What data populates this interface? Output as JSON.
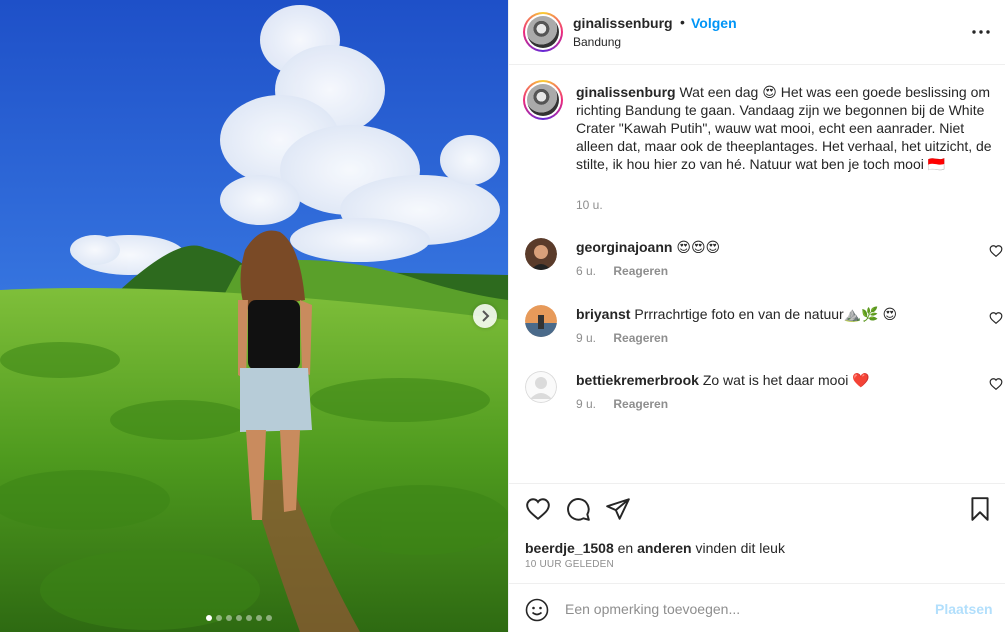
{
  "header": {
    "username": "ginalissenburg",
    "separator": "•",
    "follow_label": "Volgen",
    "location": "Bandung",
    "more_icon": "more-horizontal-icon"
  },
  "caption": {
    "username": "ginalissenburg",
    "text": "Wat een dag 😍 Het was een goede beslissing om richting Bandung te gaan. Vandaag zijn we begonnen bij de White Crater \"Kawah Putih\", wauw wat mooi, echt een aanrader. Niet alleen dat, maar ook de theeplantages. Het verhaal, het uitzicht, de stilte, ik hou hier zo van hé. Natuur wat ben je toch mooi 🇮🇩",
    "time": "10 u."
  },
  "comments": [
    {
      "username": "georginajoann",
      "text": "😍😍😍",
      "time": "6 u.",
      "reply_label": "Reageren"
    },
    {
      "username": "briyanst",
      "text": "Prrrachrtige foto en van de natuur⛰️🌿 😍",
      "time": "9 u.",
      "reply_label": "Reageren"
    },
    {
      "username": "bettiekremerbrook",
      "text": "Zo wat is het daar mooi ❤️",
      "time": "9 u.",
      "reply_label": "Reageren"
    }
  ],
  "likes": {
    "user": "beerdje_1508",
    "and": "en",
    "others": "anderen",
    "suffix": "vinden dit leuk"
  },
  "posted": "10 UUR GELEDEN",
  "comment_box": {
    "placeholder": "Een opmerking toevoegen...",
    "post_label": "Plaatsen"
  },
  "carousel": {
    "slides": 7,
    "active": 1
  },
  "colors": {
    "accent": "#0095f6",
    "muted": "#8e8e8e",
    "post_disabled": "#b2dffc",
    "heart_red": "#ed4956"
  }
}
